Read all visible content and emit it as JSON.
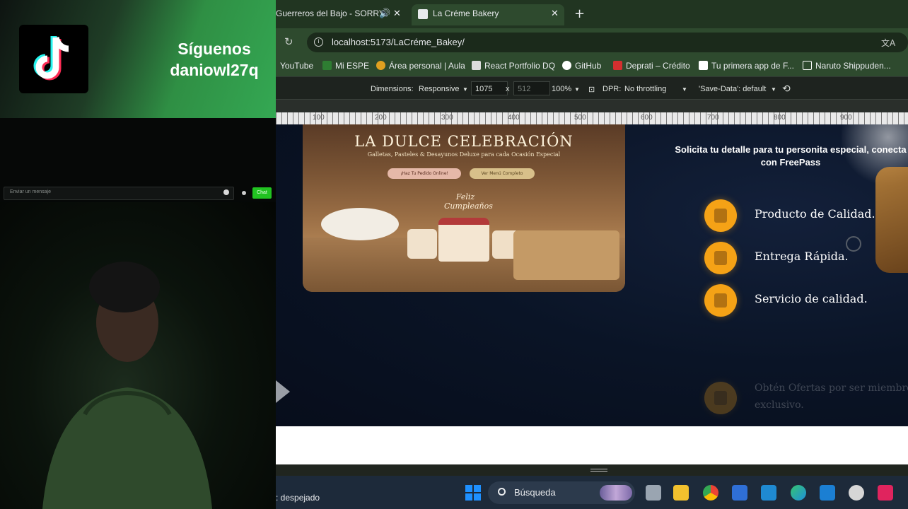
{
  "overlay": {
    "follow_line1": "Síguenos",
    "follow_line2": "daniowl27q",
    "chat_placeholder": "Enviar un mensaje",
    "chat_button": "Chat"
  },
  "tabs": [
    {
      "label": "Guerreros del Bajo - SORRY",
      "close": "✕",
      "audio_icon": "speaker-icon"
    },
    {
      "label": "La Créme Bakery",
      "close": "✕"
    }
  ],
  "new_tab": "+",
  "address": {
    "url": "localhost:5173/LaCréme_Bakey/"
  },
  "bookmarks": [
    {
      "label": "YouTube",
      "color": "#ff0000"
    },
    {
      "label": "Mi ESPE",
      "color": "#2e7d32"
    },
    {
      "label": "Área personal | Aula",
      "color": "#e0a020"
    },
    {
      "label": "React Portfolio DQ",
      "color": "#dddddd"
    },
    {
      "label": "GitHub",
      "color": "#ffffff"
    },
    {
      "label": "Deprati – Crédito",
      "color": "#d32f2f"
    },
    {
      "label": "Tu primera app de F...",
      "color": "#ffffff"
    },
    {
      "label": "Naruto Shippuden...",
      "color": "#ffffff"
    }
  ],
  "devtools": {
    "dimensions_label": "Dimensions:",
    "dimensions_value": "Responsive",
    "width": "1075",
    "times": "x",
    "height": "512",
    "zoom": "100%",
    "dpr": "DPR:",
    "throttle": "No throttling",
    "save_data": "'Save-Data': default"
  },
  "ruler_labels": [
    "100",
    "200",
    "300",
    "400",
    "500",
    "600",
    "700",
    "800",
    "900"
  ],
  "page": {
    "hero_title": "LA DULCE CELEBRACIÓN",
    "hero_subtitle": "Galletas, Pasteles & Desayunos Deluxe para cada Ocasión Especial",
    "hero_cta1": "¡Haz Tu Pedido Online!",
    "hero_cta2": "Ver Menú Completo",
    "hero_cake_text": "Feliz Cumpleaños",
    "slogan_line1": "Solicita tu detalle para tu personita especial, conecta",
    "slogan_line2": "con FreePass",
    "features": [
      {
        "label": "Producto de Calidad."
      },
      {
        "label": "Entrega Rápida."
      },
      {
        "label": "Servicio de calidad."
      },
      {
        "label": "Obtén Ofertas por ser miembro exclusivo."
      }
    ],
    "accent_color": "#f5a216"
  },
  "taskbar": {
    "weather": ": despejado",
    "search_label": "Búsqueda"
  }
}
